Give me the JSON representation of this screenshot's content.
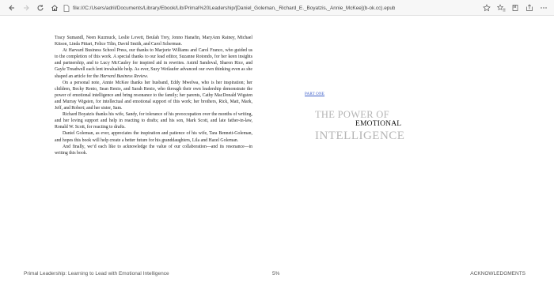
{
  "browser": {
    "url": "file:///C:/Users/adril/Documents/Library/Ebook/Lib/Primal%20Leadership/[Daniel_Goleman,_Richard_E._Boyatzis,_Annie_McKee](b-ok.cc).epub",
    "icons": [
      "back-icon",
      "forward-icon",
      "refresh-icon",
      "home-icon",
      "page-icon",
      "star-icon",
      "favorites-icon",
      "reading-list-icon",
      "share-icon",
      "more-icon"
    ]
  },
  "left_page": {
    "paragraphs": [
      {
        "indent": false,
        "text": "Tracy Sumandl, Neen Kuzmuck, Leslie Lovett, Beulah Trey, Jonno Hanafin, MaryAnn Rainey, Michael Kitson, Linda Pittari, Felice Tilin, David Smith, and Carol Scherman."
      },
      {
        "indent": true,
        "text": "At Harvard Business School Press, our thanks to Marjorie Williams and Carol Franco, who guided us to the completion of this work. A special thanks to our lead editor, Suzanne Rotondo, for her keen insights and partnership, and to Lucy McCauley for inspired aid in rewrites. Astrid Sandoval, Sharon Rice, and Gayle Treadwell each lent invaluable help. As ever, Suzy Wetlaufer advanced our own thinking even as she shaped an article for the Harvard Business Review."
      },
      {
        "indent": true,
        "text": "On a personal note, Annie McKee thanks her husband, Eddy Mwelwa, who is her inspiration; her children, Becky Renio, Sean Renio, and Sarah Renio, who through their own leadership demonstrate the power of emotional intelligence and bring resonance to the family; her parents, Cathy MacDonald Wigsten and Murray Wigsten, for intellectual and emotional support of this work; her brothers, Rick, Matt, Mark, Jeff, and Robert; and her sister, Sam."
      },
      {
        "indent": true,
        "text": "Richard Boyatzis thanks his wife, Sandy, for tolerance of his preoccupation over the months of writing, and her loving support and help in reacting to drafts; and his son, Mark Scott, and late father-in-law, Ronald W. Scott, for reacting to drafts."
      },
      {
        "indent": true,
        "text": "Daniel Goleman, as ever, appreciates the inspiration and patience of his wife, Tara Bennett-Goleman, and hopes this book will help create a better future for his granddaughters, Lila and Hazel Goleman."
      },
      {
        "indent": true,
        "text": "And finally, we’d each like to acknowledge the value of our collaboration—and its resonance—in writing this book."
      }
    ]
  },
  "right_page": {
    "part_label": "PART ONE",
    "title_line1": "THE POWER OF",
    "title_line2": "EMOTIONAL",
    "title_line3": "INTELLIGENCE"
  },
  "footer": {
    "book_title": "Primal Leadership: Learning to Lead with Emotional Intelligence",
    "progress": "5%",
    "chapter": "ACKNOWLEDGMENTS"
  }
}
